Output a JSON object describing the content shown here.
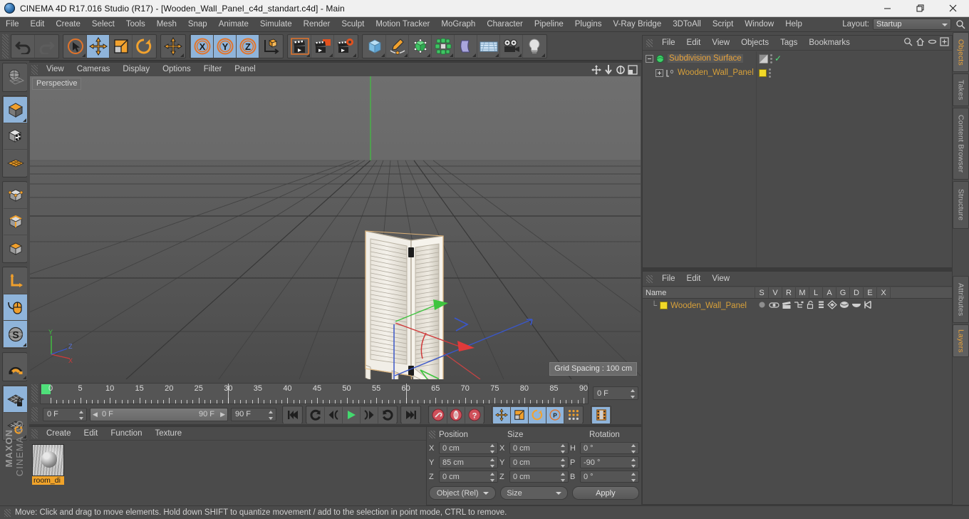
{
  "window": {
    "title": "CINEMA 4D R17.016 Studio (R17) - [Wooden_Wall_Panel_c4d_standart.c4d] - Main",
    "app_icon": "cinema4d-logo-icon",
    "minimize": "minimize-icon",
    "maximize": "maximize-icon",
    "close": "close-icon"
  },
  "menubar": {
    "items": [
      "File",
      "Edit",
      "Create",
      "Select",
      "Tools",
      "Mesh",
      "Snap",
      "Animate",
      "Simulate",
      "Render",
      "Sculpt",
      "Motion Tracker",
      "MoGraph",
      "Character",
      "Pipeline",
      "Plugins",
      "V-Ray Bridge",
      "3DToAll",
      "Script",
      "Window",
      "Help"
    ],
    "layout_label": "Layout:",
    "layout_value": "Startup",
    "search_icon": "search-icon"
  },
  "toolbar": {
    "groups": [
      {
        "name": "history",
        "buttons": [
          {
            "name": "undo-button",
            "icon": "undo-arrow-icon",
            "selected": false,
            "disabled": false,
            "corner": false
          },
          {
            "name": "redo-button",
            "icon": "redo-arrow-icon",
            "selected": false,
            "disabled": true,
            "corner": false
          }
        ]
      },
      {
        "name": "transform-tools",
        "buttons": [
          {
            "name": "live-selection-tool",
            "icon": "cursor-circle-icon",
            "selected": false,
            "disabled": false,
            "corner": true
          },
          {
            "name": "move-tool",
            "icon": "move-arrows-icon",
            "selected": true,
            "disabled": false,
            "corner": false
          },
          {
            "name": "scale-tool",
            "icon": "scale-box-icon",
            "selected": false,
            "disabled": false,
            "corner": false
          },
          {
            "name": "rotate-tool",
            "icon": "rotate-circle-icon",
            "selected": false,
            "disabled": false,
            "corner": false
          }
        ]
      },
      {
        "name": "world-axis",
        "buttons": [
          {
            "name": "axis-move-tool",
            "icon": "move-arrows-icon",
            "selected": false,
            "disabled": false,
            "corner": true
          }
        ]
      },
      {
        "name": "axis-locks",
        "buttons": [
          {
            "name": "lock-x-axis",
            "icon": "x-axis-icon",
            "selected": true,
            "disabled": false,
            "corner": false
          },
          {
            "name": "lock-y-axis",
            "icon": "y-axis-icon",
            "selected": true,
            "disabled": false,
            "corner": false
          },
          {
            "name": "lock-z-axis",
            "icon": "z-axis-icon",
            "selected": true,
            "disabled": false,
            "corner": false
          },
          {
            "name": "world-object-coordinates",
            "icon": "world-axis-cube-icon",
            "selected": false,
            "disabled": false,
            "corner": false
          }
        ]
      },
      {
        "name": "render-group",
        "buttons": [
          {
            "name": "render-view-button",
            "icon": "render-clapper-icon",
            "selected": false,
            "disabled": false,
            "corner": true
          },
          {
            "name": "render-to-picture-viewer-button",
            "icon": "render-picture-icon",
            "selected": false,
            "disabled": false,
            "corner": true
          },
          {
            "name": "render-settings-button",
            "icon": "render-settings-gear-icon",
            "selected": false,
            "disabled": false,
            "corner": true
          }
        ]
      },
      {
        "name": "create-group",
        "buttons": [
          {
            "name": "add-primitive-button",
            "icon": "cube-blue-icon",
            "selected": false,
            "disabled": false,
            "corner": true
          },
          {
            "name": "add-spline-button",
            "icon": "pen-spline-icon",
            "selected": false,
            "disabled": false,
            "corner": true
          },
          {
            "name": "add-generator-button",
            "icon": "generator-green-cube-icon",
            "selected": false,
            "disabled": false,
            "corner": true
          },
          {
            "name": "add-array-button",
            "icon": "array-green-icon",
            "selected": false,
            "disabled": false,
            "corner": true
          },
          {
            "name": "add-deformer-button",
            "icon": "bend-deformer-icon",
            "selected": false,
            "disabled": false,
            "corner": true
          },
          {
            "name": "add-environment-button",
            "icon": "floor-grid-icon",
            "selected": false,
            "disabled": false,
            "corner": true
          },
          {
            "name": "add-camera-button",
            "icon": "camera-icon",
            "selected": false,
            "disabled": false,
            "corner": true
          },
          {
            "name": "add-light-button",
            "icon": "light-bulb-icon",
            "selected": false,
            "disabled": false,
            "corner": true
          }
        ]
      }
    ]
  },
  "left_toolbar": {
    "groups": [
      {
        "buttons": [
          {
            "name": "undo-view-button",
            "icon": "globe-wire-icon",
            "selected": false,
            "corner": false
          }
        ]
      },
      {
        "buttons": [
          {
            "name": "make-editable-button",
            "icon": "editable-cube-icon",
            "selected": true,
            "corner": true
          },
          {
            "name": "texture-mode-button",
            "icon": "texture-cube-icon",
            "selected": false,
            "corner": false
          },
          {
            "name": "viewport-solo-button",
            "icon": "orange-grid-icon",
            "selected": false,
            "corner": false
          }
        ]
      },
      {
        "buttons": [
          {
            "name": "point-mode-button",
            "icon": "points-cube-icon",
            "selected": false,
            "corner": false
          },
          {
            "name": "edge-mode-button",
            "icon": "edges-cube-icon",
            "selected": false,
            "corner": false
          },
          {
            "name": "polygon-mode-button",
            "icon": "polygon-cube-icon",
            "selected": false,
            "corner": false
          }
        ]
      },
      {
        "buttons": [
          {
            "name": "axis-modification-button",
            "icon": "axis-l-icon",
            "selected": false,
            "corner": false
          },
          {
            "name": "enable-snapping-button",
            "icon": "mouse-snap-icon",
            "selected": true,
            "corner": false
          },
          {
            "name": "soft-selection-button",
            "icon": "s-sphere-icon",
            "selected": true,
            "corner": true
          }
        ]
      },
      {
        "buttons": [
          {
            "name": "magnet-tool-button",
            "icon": "magnet-icon",
            "selected": false,
            "corner": true
          }
        ]
      },
      {
        "buttons": [
          {
            "name": "lock-workplane-button",
            "icon": "workplane-lock-icon",
            "selected": true,
            "corner": false
          },
          {
            "name": "workplane-rotate-button",
            "icon": "workplane-rotate-icon",
            "selected": false,
            "corner": true
          }
        ]
      }
    ],
    "brand_line1": "MAXON",
    "brand_line2": "CINEMA 4D"
  },
  "viewport": {
    "menu_items": [
      "View",
      "Cameras",
      "Display",
      "Options",
      "Filter",
      "Panel"
    ],
    "label": "Perspective",
    "grid_spacing": "Grid Spacing : 100 cm",
    "axis_gizmo": {
      "x": "X",
      "y": "Y",
      "z": "Z"
    },
    "view_icons": [
      "pan-view-icon",
      "dolly-view-icon",
      "rotate-view-icon",
      "maximize-view-icon"
    ],
    "scene_object": "Wooden_Wall_Panel",
    "colors": {
      "bg_top": "#6a6a6a",
      "bg_bottom": "#4f4f4f",
      "grid_line": "#4a4a4a",
      "x_axis": "#d04a4a",
      "y_axis": "#4cc44c",
      "z_axis": "#4a63d0"
    }
  },
  "timeline": {
    "ruler_min": 0,
    "ruler_max": 90,
    "ruler_labels": [
      "0",
      "5",
      "10",
      "15",
      "20",
      "25",
      "30",
      "35",
      "40",
      "45",
      "50",
      "55",
      "60",
      "65",
      "70",
      "75",
      "80",
      "85",
      "90"
    ],
    "current_frame_field": "0 F",
    "preview_start": "0 F",
    "preview_end": "90 F",
    "range_end_field": "90 F",
    "start_field": "0 F",
    "right_frame_field": "0 F",
    "transport": [
      {
        "name": "go-to-start-button",
        "icon": "skip-start-icon"
      },
      {
        "name": "play-backwards-loop-button",
        "icon": "loop-arrow-icon"
      },
      {
        "name": "previous-frame-button",
        "icon": "step-back-icon"
      },
      {
        "name": "play-button",
        "icon": "play-triangle-icon"
      },
      {
        "name": "next-frame-button",
        "icon": "step-forward-icon"
      },
      {
        "name": "play-forward-loop-button",
        "icon": "loop-forward-icon"
      },
      {
        "name": "go-to-end-button",
        "icon": "skip-end-icon"
      }
    ],
    "keyframe_buttons": [
      {
        "name": "record-active-objects-button",
        "icon": "record-key-icon"
      },
      {
        "name": "autokeying-button",
        "icon": "autokey-icon"
      },
      {
        "name": "keyframe-selection-button",
        "icon": "question-key-icon"
      }
    ],
    "key_toggles": [
      {
        "name": "position-key-toggle",
        "icon": "move-arrows-icon",
        "selected": true
      },
      {
        "name": "scale-key-toggle",
        "icon": "scale-box-icon",
        "selected": true
      },
      {
        "name": "rotation-key-toggle",
        "icon": "rotate-circle-icon",
        "selected": true
      },
      {
        "name": "parameter-key-toggle",
        "icon": "p-circle-icon",
        "selected": true
      },
      {
        "name": "point-level-animation-toggle",
        "icon": "pla-dots-icon",
        "selected": false
      }
    ],
    "timeline_toggle": {
      "name": "timeline-view-button",
      "icon": "film-strip-icon",
      "selected": true
    }
  },
  "material_manager": {
    "menu_items": [
      "Create",
      "Edit",
      "Function",
      "Texture"
    ],
    "materials": [
      {
        "name": "room_di",
        "thumb": "material-sphere-thumb"
      }
    ]
  },
  "coordinates": {
    "headers": [
      "Position",
      "Size",
      "Rotation"
    ],
    "rows": [
      {
        "pos_axis": "X",
        "pos_value": "0 cm",
        "size_axis": "X",
        "size_value": "0 cm",
        "rot_axis": "H",
        "rot_value": "0 °"
      },
      {
        "pos_axis": "Y",
        "pos_value": "85 cm",
        "size_axis": "Y",
        "size_value": "0 cm",
        "rot_axis": "P",
        "rot_value": "-90 °"
      },
      {
        "pos_axis": "Z",
        "pos_value": "0 cm",
        "size_axis": "Z",
        "size_value": "0 cm",
        "rot_axis": "B",
        "rot_value": "0 °"
      }
    ],
    "mode_dropdown": "Object (Rel)",
    "size_dropdown": "Size",
    "apply_button": "Apply"
  },
  "object_manager": {
    "menu_items": [
      "File",
      "Edit",
      "View",
      "Objects",
      "Tags",
      "Bookmarks"
    ],
    "header_icons": [
      "search-icon",
      "home-icon",
      "ellipse-icon",
      "add-layer-icon"
    ],
    "rows": [
      {
        "label": "Subdivision Surface",
        "icon": "subdivision-surface-icon",
        "indent": 0,
        "expander": "minus",
        "tag": "checker-tag",
        "check": "✓",
        "selected": true
      },
      {
        "label": "Wooden_Wall_Panel",
        "icon": "polygon-object-icon",
        "indent": 1,
        "expander": "plus",
        "tag": "yellow-material-tag",
        "check": "",
        "selected": false
      }
    ]
  },
  "layer_manager": {
    "menu_items": [
      "File",
      "Edit",
      "View"
    ],
    "columns": [
      "Name",
      "S",
      "V",
      "R",
      "M",
      "L",
      "A",
      "G",
      "D",
      "E",
      "X"
    ],
    "rows": [
      {
        "name": "Wooden_Wall_Panel",
        "swatch": "#f2d928",
        "icons": [
          "solo-dot-icon",
          "visible-eye-icon",
          "render-clapper-icon",
          "manager-icon",
          "lock-open-icon",
          "animation-icon",
          "generator-icon",
          "deformer-icon",
          "expression-icon",
          "xref-icon"
        ]
      }
    ]
  },
  "vertical_tabs": [
    {
      "label": "Objects",
      "active": true
    },
    {
      "label": "Takes",
      "active": false
    },
    {
      "label": "Content Browser",
      "active": false
    },
    {
      "label": "Structure",
      "active": false
    },
    {
      "label": "Attributes",
      "active": false
    },
    {
      "label": "Layers",
      "active": true
    }
  ],
  "statusbar": {
    "message": "Move: Click and drag to move elements. Hold down SHIFT to quantize movement / add to the selection in point mode, CTRL to remove."
  }
}
